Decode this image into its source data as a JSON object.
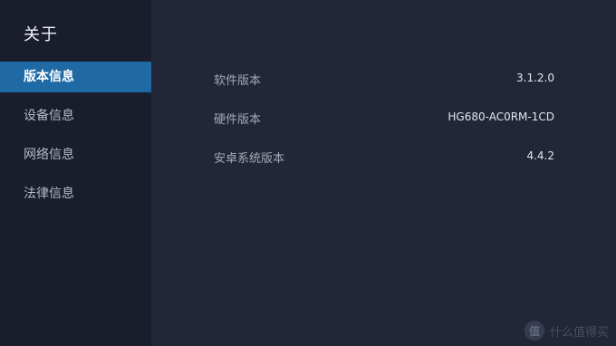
{
  "header": {
    "title": "关于"
  },
  "sidebar": {
    "items": [
      {
        "label": "版本信息",
        "active": true
      },
      {
        "label": "设备信息",
        "active": false
      },
      {
        "label": "网络信息",
        "active": false
      },
      {
        "label": "法律信息",
        "active": false
      }
    ]
  },
  "main": {
    "rows": [
      {
        "label": "软件版本",
        "value": "3.1.2.0"
      },
      {
        "label": "硬件版本",
        "value": "HG680-AC0RM-1CD"
      },
      {
        "label": "安卓系统版本",
        "value": "4.4.2"
      }
    ]
  },
  "watermark": {
    "glyph": "值",
    "text": "什么值得买"
  },
  "colors": {
    "background": "#202536",
    "sidebar": "#191d2c",
    "accent": "#1f6aa5"
  }
}
